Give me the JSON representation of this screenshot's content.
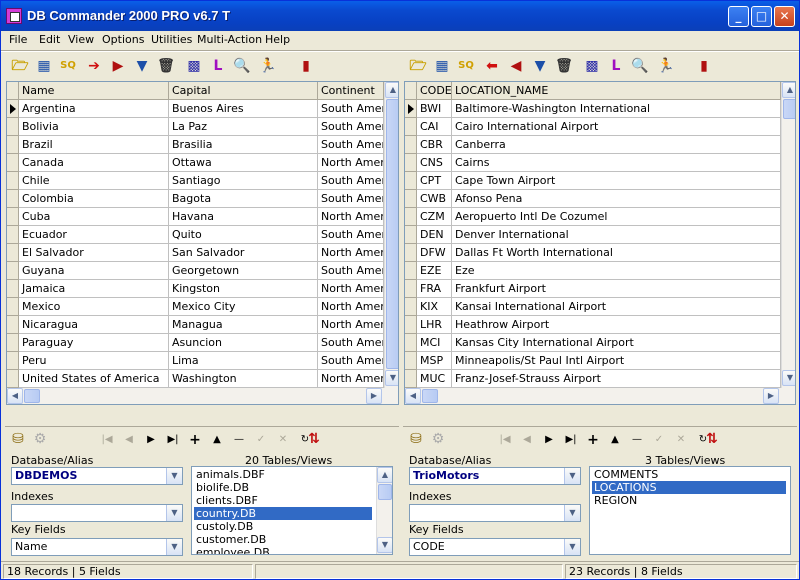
{
  "window": {
    "title": "DB Commander 2000 PRO v6.7 T",
    "min_label": "_",
    "max_label": "□",
    "close_label": "✕"
  },
  "menu": [
    {
      "label": "File"
    },
    {
      "label": "Edit"
    },
    {
      "label": "View"
    },
    {
      "label": "Options"
    },
    {
      "label": "Utilities"
    },
    {
      "label": "Multi-Action"
    },
    {
      "label": "Help"
    }
  ],
  "toolbar_icons": [
    "open-folder-icon",
    "table-icon",
    "sql-icon",
    "arrow-right-icon",
    "export-icon",
    "filter-icon",
    "trash-icon",
    "grid-icon",
    "index-icon",
    "search-icon",
    "run-icon",
    "exit-icon"
  ],
  "left": {
    "grid": {
      "columns": [
        "Name",
        "Capital",
        "Continent"
      ],
      "rows": [
        [
          "Argentina",
          "Buenos Aires",
          "South America"
        ],
        [
          "Bolivia",
          "La Paz",
          "South America"
        ],
        [
          "Brazil",
          "Brasilia",
          "South America"
        ],
        [
          "Canada",
          "Ottawa",
          "North America"
        ],
        [
          "Chile",
          "Santiago",
          "South America"
        ],
        [
          "Colombia",
          "Bagota",
          "South America"
        ],
        [
          "Cuba",
          "Havana",
          "North America"
        ],
        [
          "Ecuador",
          "Quito",
          "South America"
        ],
        [
          "El Salvador",
          "San Salvador",
          "North America"
        ],
        [
          "Guyana",
          "Georgetown",
          "South America"
        ],
        [
          "Jamaica",
          "Kingston",
          "North America"
        ],
        [
          "Mexico",
          "Mexico City",
          "North America"
        ],
        [
          "Nicaragua",
          "Managua",
          "North America"
        ],
        [
          "Paraguay",
          "Asuncion",
          "South America"
        ],
        [
          "Peru",
          "Lima",
          "South America"
        ],
        [
          "United States of America",
          "Washington",
          "North America"
        ]
      ]
    },
    "db_label": "Database/Alias",
    "db_value": "DBDEMOS",
    "tables_count": "20 Tables/Views",
    "tables": [
      "animals.DBF",
      "biolife.DB",
      "clients.DBF",
      "country.DB",
      "custoly.DB",
      "customer.DB",
      "employee.DB"
    ],
    "selected_table": "country.DB",
    "indexes_label": "Indexes",
    "indexes_value": "",
    "key_label": "Key Fields",
    "key_value": "Name",
    "status_records": "18 Records",
    "status_fields": "5 Fields"
  },
  "right": {
    "grid": {
      "columns": [
        "CODE",
        "LOCATION_NAME"
      ],
      "rows": [
        [
          "BWI",
          "Baltimore-Washington International"
        ],
        [
          "CAI",
          "Cairo International Airport"
        ],
        [
          "CBR",
          "Canberra"
        ],
        [
          "CNS",
          "Cairns"
        ],
        [
          "CPT",
          "Cape Town Airport"
        ],
        [
          "CWB",
          "Afonso Pena"
        ],
        [
          "CZM",
          "Aeropuerto Intl De Cozumel"
        ],
        [
          "DEN",
          "Denver International"
        ],
        [
          "DFW",
          "Dallas Ft Worth International"
        ],
        [
          "EZE",
          "Eze"
        ],
        [
          "FRA",
          "Frankfurt Airport"
        ],
        [
          "KIX",
          "Kansai International Airport"
        ],
        [
          "LHR",
          "Heathrow Airport"
        ],
        [
          "MCI",
          "Kansas City International Airport"
        ],
        [
          "MSP",
          "Minneapolis/St Paul Intl Airport"
        ],
        [
          "MUC",
          "Franz-Josef-Strauss Airport"
        ]
      ]
    },
    "db_label": "Database/Alias",
    "db_value": "TrioMotors",
    "tables_count": "3 Tables/Views",
    "tables": [
      "COMMENTS",
      "LOCATIONS",
      "REGION"
    ],
    "selected_table": "LOCATIONS",
    "indexes_label": "Indexes",
    "indexes_value": "",
    "key_label": "Key Fields",
    "key_value": "CODE",
    "status_records": "23 Records",
    "status_fields": "8 Fields"
  },
  "nav_glyphs": {
    "first": "|◀",
    "prior": "◀",
    "next": "▶",
    "last": "▶|",
    "insert": "+",
    "delete": "—",
    "edit": "▲",
    "post": "✓",
    "cancel": "✕",
    "refresh": "↻"
  }
}
